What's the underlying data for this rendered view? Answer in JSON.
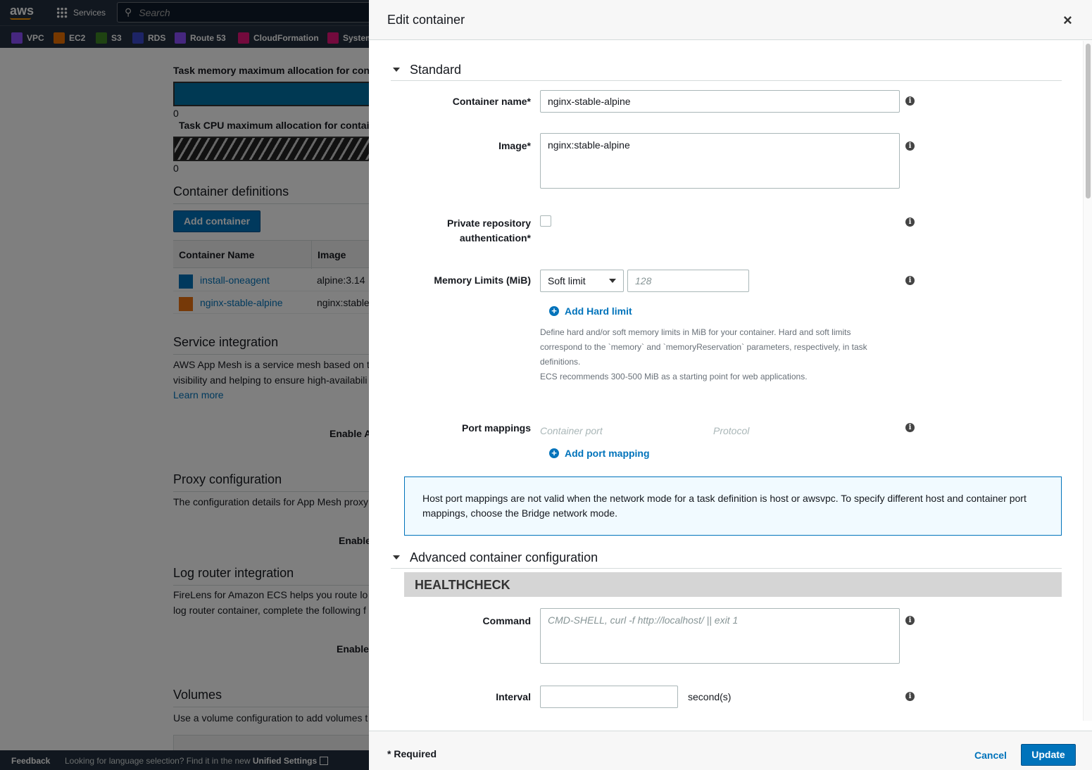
{
  "nav": {
    "logo": "aws",
    "services": "Services",
    "search_placeholder": "Search",
    "favorites": [
      {
        "label": "VPC",
        "color": "#8c4fff"
      },
      {
        "label": "EC2",
        "color": "#ed7100"
      },
      {
        "label": "S3",
        "color": "#3f8624"
      },
      {
        "label": "RDS",
        "color": "#3b48cc"
      },
      {
        "label": "Route 53",
        "color": "#8c4fff"
      },
      {
        "label": "CloudFormation",
        "color": "#e7157b"
      },
      {
        "label": "System",
        "color": "#e7157b"
      }
    ]
  },
  "background": {
    "memory_title": "Task memory maximum allocation for con",
    "memory_zero": "0",
    "cpu_title": "Task CPU maximum allocation for contai",
    "cpu_zero": "0",
    "container_defs": "Container definitions",
    "add_container": "Add container",
    "col_name": "Container Name",
    "col_image": "Image",
    "rows": [
      {
        "name": "install-oneagent",
        "image": "alpine:3.14",
        "color": "#0073bb"
      },
      {
        "name": "nginx-stable-alpine",
        "image": "nginx:stable",
        "color": "#ec7211"
      }
    ],
    "service_integration": "Service integration",
    "si_text1": "AWS App Mesh is a service mesh based on t",
    "si_text2": "visibility and helping to ensure high-availabili",
    "learn_more": "Learn more",
    "enable_a": "Enable A",
    "proxy": "Proxy configuration",
    "proxy_text": "The configuration details for App Mesh proxy",
    "enable_p": "Enable",
    "log_router": "Log router integration",
    "lr_text1": "FireLens for Amazon ECS helps you route lo",
    "lr_text2": "log router container, complete the following f",
    "enable_l": "Enable",
    "volumes": "Volumes",
    "vol_text": "Use a volume configuration to add volumes t"
  },
  "footer": {
    "feedback": "Feedback",
    "language": "Looking for language selection? Find it in the new ",
    "unified": "Unified Settings"
  },
  "modal": {
    "title": "Edit container",
    "close": "×",
    "standard": "Standard",
    "container_name_label": "Container name*",
    "container_name": "nginx-stable-alpine",
    "image_label": "Image*",
    "image": "nginx:stable-alpine",
    "private_repo_label1": "Private repository",
    "private_repo_label2": "authentication*",
    "memory_label": "Memory Limits (MiB)",
    "memory_type": "Soft limit",
    "memory_placeholder": "128",
    "add_hard_limit": "Add Hard limit",
    "help1": "Define hard and/or soft memory limits in MiB for your container. Hard and soft limits",
    "help2": "correspond to the `memory` and `memoryReservation` parameters, respectively, in task",
    "help3": "definitions.",
    "help4": "ECS recommends 300-500 MiB as a starting point for web applications.",
    "port_label": "Port mappings",
    "container_port_ph": "Container port",
    "protocol_ph": "Protocol",
    "add_port": "Add port mapping",
    "notice": "Host port mappings are not valid when the network mode for a task definition is host or awsvpc. To specify different host and container port mappings, choose the Bridge network mode.",
    "advanced": "Advanced container configuration",
    "healthcheck": "HEALTHCHECK",
    "command_label": "Command",
    "command_placeholder": "CMD-SHELL, curl -f http://localhost/ || exit 1",
    "interval_label": "Interval",
    "interval_unit": "second(s)",
    "required": "* Required",
    "cancel": "Cancel",
    "update": "Update"
  }
}
